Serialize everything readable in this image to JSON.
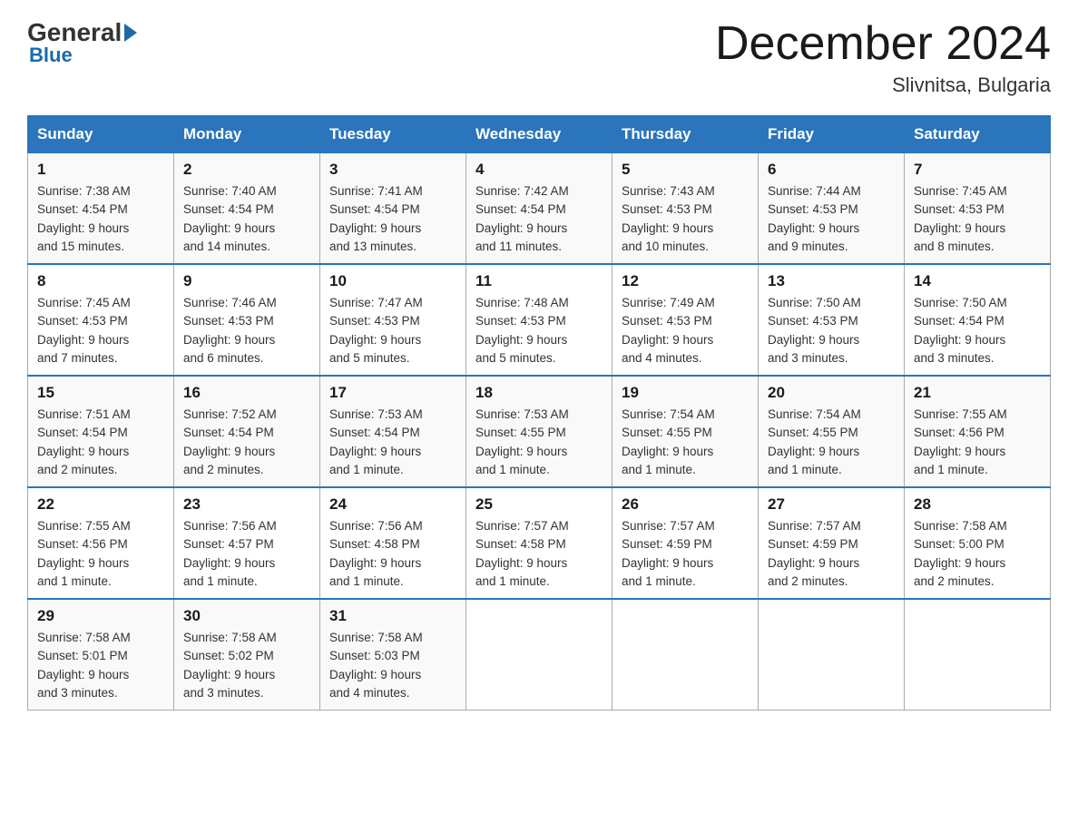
{
  "header": {
    "logo_general": "General",
    "logo_blue": "Blue",
    "month_title": "December 2024",
    "location": "Slivnitsa, Bulgaria"
  },
  "weekdays": [
    "Sunday",
    "Monday",
    "Tuesday",
    "Wednesday",
    "Thursday",
    "Friday",
    "Saturday"
  ],
  "weeks": [
    [
      {
        "day": "1",
        "sunrise": "7:38 AM",
        "sunset": "4:54 PM",
        "daylight": "9 hours and 15 minutes."
      },
      {
        "day": "2",
        "sunrise": "7:40 AM",
        "sunset": "4:54 PM",
        "daylight": "9 hours and 14 minutes."
      },
      {
        "day": "3",
        "sunrise": "7:41 AM",
        "sunset": "4:54 PM",
        "daylight": "9 hours and 13 minutes."
      },
      {
        "day": "4",
        "sunrise": "7:42 AM",
        "sunset": "4:54 PM",
        "daylight": "9 hours and 11 minutes."
      },
      {
        "day": "5",
        "sunrise": "7:43 AM",
        "sunset": "4:53 PM",
        "daylight": "9 hours and 10 minutes."
      },
      {
        "day": "6",
        "sunrise": "7:44 AM",
        "sunset": "4:53 PM",
        "daylight": "9 hours and 9 minutes."
      },
      {
        "day": "7",
        "sunrise": "7:45 AM",
        "sunset": "4:53 PM",
        "daylight": "9 hours and 8 minutes."
      }
    ],
    [
      {
        "day": "8",
        "sunrise": "7:45 AM",
        "sunset": "4:53 PM",
        "daylight": "9 hours and 7 minutes."
      },
      {
        "day": "9",
        "sunrise": "7:46 AM",
        "sunset": "4:53 PM",
        "daylight": "9 hours and 6 minutes."
      },
      {
        "day": "10",
        "sunrise": "7:47 AM",
        "sunset": "4:53 PM",
        "daylight": "9 hours and 5 minutes."
      },
      {
        "day": "11",
        "sunrise": "7:48 AM",
        "sunset": "4:53 PM",
        "daylight": "9 hours and 5 minutes."
      },
      {
        "day": "12",
        "sunrise": "7:49 AM",
        "sunset": "4:53 PM",
        "daylight": "9 hours and 4 minutes."
      },
      {
        "day": "13",
        "sunrise": "7:50 AM",
        "sunset": "4:53 PM",
        "daylight": "9 hours and 3 minutes."
      },
      {
        "day": "14",
        "sunrise": "7:50 AM",
        "sunset": "4:54 PM",
        "daylight": "9 hours and 3 minutes."
      }
    ],
    [
      {
        "day": "15",
        "sunrise": "7:51 AM",
        "sunset": "4:54 PM",
        "daylight": "9 hours and 2 minutes."
      },
      {
        "day": "16",
        "sunrise": "7:52 AM",
        "sunset": "4:54 PM",
        "daylight": "9 hours and 2 minutes."
      },
      {
        "day": "17",
        "sunrise": "7:53 AM",
        "sunset": "4:54 PM",
        "daylight": "9 hours and 1 minute."
      },
      {
        "day": "18",
        "sunrise": "7:53 AM",
        "sunset": "4:55 PM",
        "daylight": "9 hours and 1 minute."
      },
      {
        "day": "19",
        "sunrise": "7:54 AM",
        "sunset": "4:55 PM",
        "daylight": "9 hours and 1 minute."
      },
      {
        "day": "20",
        "sunrise": "7:54 AM",
        "sunset": "4:55 PM",
        "daylight": "9 hours and 1 minute."
      },
      {
        "day": "21",
        "sunrise": "7:55 AM",
        "sunset": "4:56 PM",
        "daylight": "9 hours and 1 minute."
      }
    ],
    [
      {
        "day": "22",
        "sunrise": "7:55 AM",
        "sunset": "4:56 PM",
        "daylight": "9 hours and 1 minute."
      },
      {
        "day": "23",
        "sunrise": "7:56 AM",
        "sunset": "4:57 PM",
        "daylight": "9 hours and 1 minute."
      },
      {
        "day": "24",
        "sunrise": "7:56 AM",
        "sunset": "4:58 PM",
        "daylight": "9 hours and 1 minute."
      },
      {
        "day": "25",
        "sunrise": "7:57 AM",
        "sunset": "4:58 PM",
        "daylight": "9 hours and 1 minute."
      },
      {
        "day": "26",
        "sunrise": "7:57 AM",
        "sunset": "4:59 PM",
        "daylight": "9 hours and 1 minute."
      },
      {
        "day": "27",
        "sunrise": "7:57 AM",
        "sunset": "4:59 PM",
        "daylight": "9 hours and 2 minutes."
      },
      {
        "day": "28",
        "sunrise": "7:58 AM",
        "sunset": "5:00 PM",
        "daylight": "9 hours and 2 minutes."
      }
    ],
    [
      {
        "day": "29",
        "sunrise": "7:58 AM",
        "sunset": "5:01 PM",
        "daylight": "9 hours and 3 minutes."
      },
      {
        "day": "30",
        "sunrise": "7:58 AM",
        "sunset": "5:02 PM",
        "daylight": "9 hours and 3 minutes."
      },
      {
        "day": "31",
        "sunrise": "7:58 AM",
        "sunset": "5:03 PM",
        "daylight": "9 hours and 4 minutes."
      },
      null,
      null,
      null,
      null
    ]
  ],
  "labels": {
    "sunrise": "Sunrise:",
    "sunset": "Sunset:",
    "daylight": "Daylight:"
  }
}
